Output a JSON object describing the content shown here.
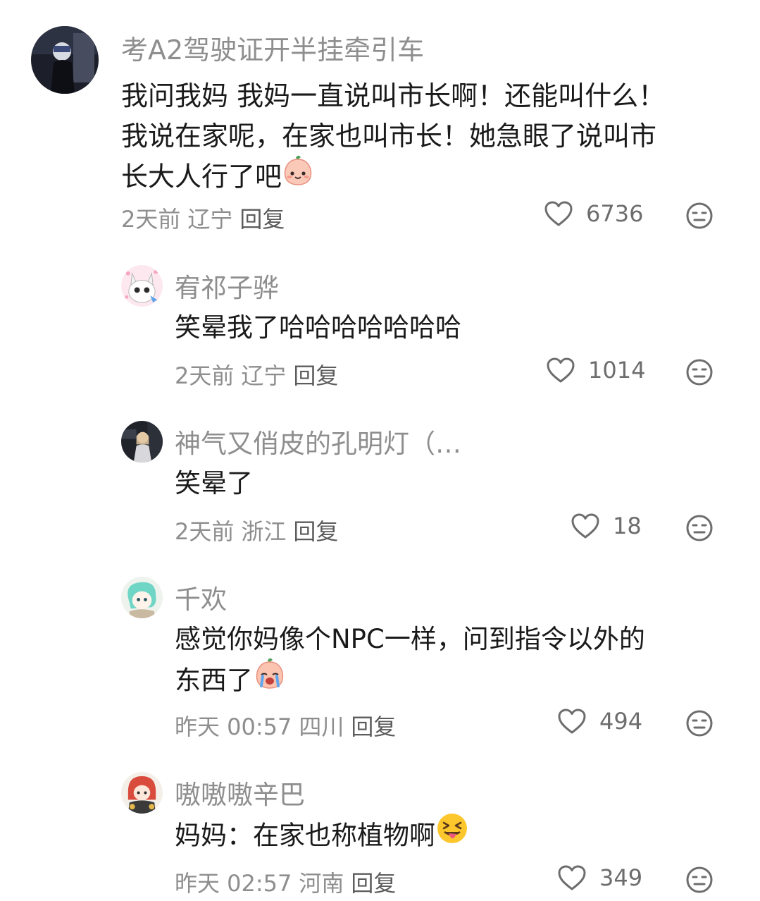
{
  "comments": [
    {
      "username": "考A2驾驶证开半挂牵引车",
      "lines": [
        "我问我妈 我妈一直说叫市长啊！还能叫什么！",
        "我说在家呢，在家也叫市长！她急眼了说叫市",
        "长大人行了吧"
      ],
      "emoji": "peach-smile-emoji",
      "time": "2天前",
      "location": "辽宁",
      "reply_label": "回复",
      "likes": "6736"
    },
    {
      "username": "宥祁子骅",
      "lines": [
        "笑晕我了哈哈哈哈哈哈哈"
      ],
      "time": "2天前",
      "location": "辽宁",
      "reply_label": "回复",
      "likes": "1014"
    },
    {
      "username": "神气又俏皮的孔明灯（…",
      "lines": [
        "笑晕了"
      ],
      "time": "2天前",
      "location": "浙江",
      "reply_label": "回复",
      "likes": "18"
    },
    {
      "username": "千欢",
      "lines": [
        "感觉你妈像个NPC一样，问到指令以外的",
        "东西了"
      ],
      "emoji": "peach-cry-emoji",
      "time": "昨天 00:57",
      "location": "四川",
      "reply_label": "回复",
      "likes": "494"
    },
    {
      "username": "嗷嗷嗷辛巴",
      "lines": [
        "妈妈：在家也称植物啊"
      ],
      "emoji": "squinting-tongue-emoji",
      "time": "昨天 02:57",
      "location": "河南",
      "reply_label": "回复",
      "likes": "349"
    }
  ],
  "colors": {
    "meta_gray": "#8e8e8e",
    "text": "#1a1a1a",
    "icon": "#6d6d6d"
  }
}
